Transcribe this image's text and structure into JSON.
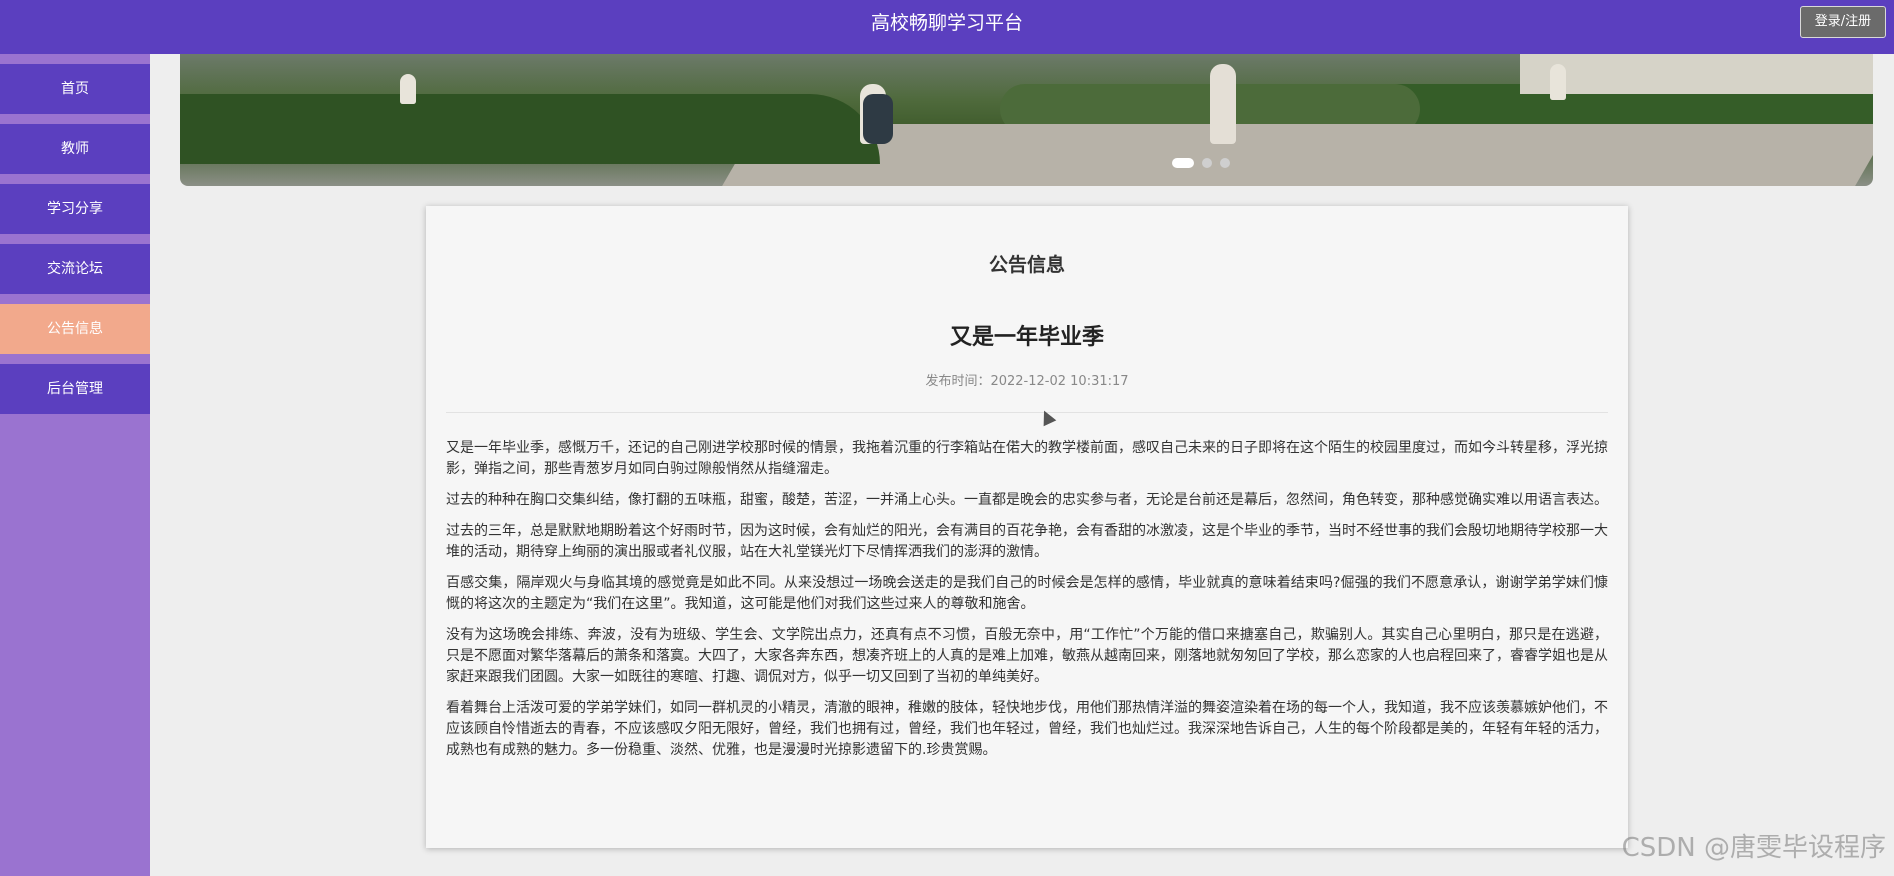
{
  "header": {
    "title": "高校畅聊学习平台",
    "login_label": "登录/注册"
  },
  "sidebar": {
    "items": [
      {
        "label": "首页"
      },
      {
        "label": "教师"
      },
      {
        "label": "学习分享"
      },
      {
        "label": "交流论坛"
      },
      {
        "label": "公告信息",
        "active": true
      },
      {
        "label": "后台管理"
      }
    ]
  },
  "banner": {
    "slide_count": 3,
    "active_index": 0
  },
  "notice": {
    "section_title": "公告信息",
    "title": "又是一年毕业季",
    "publish_label": "发布时间：",
    "publish_time": "2022-12-02 10:31:17",
    "paragraphs": [
      "又是一年毕业季，感慨万千，还记的自己刚进学校那时候的情景，我拖着沉重的行李箱站在偌大的教学楼前面，感叹自己未来的日子即将在这个陌生的校园里度过，而如今斗转星移，浮光掠影，弹指之间，那些青葱岁月如同白驹过隙般悄然从指缝溜走。",
      "过去的种种在胸口交集纠结，像打翻的五味瓶，甜蜜，酸楚，苦涩，一并涌上心头。一直都是晚会的忠实参与者，无论是台前还是幕后，忽然间，角色转变，那种感觉确实难以用语言表达。",
      "过去的三年，总是默默地期盼着这个好雨时节，因为这时候，会有灿烂的阳光，会有满目的百花争艳，会有香甜的冰激凌，这是个毕业的季节，当时不经世事的我们会殷切地期待学校那一大堆的活动，期待穿上绚丽的演出服或者礼仪服，站在大礼堂镁光灯下尽情挥洒我们的澎湃的激情。",
      "百感交集，隔岸观火与身临其境的感觉竟是如此不同。从来没想过一场晚会送走的是我们自己的时候会是怎样的感情，毕业就真的意味着结束吗?倔强的我们不愿意承认，谢谢学弟学妹们慷慨的将这次的主题定为“我们在这里”。我知道，这可能是他们对我们这些过来人的尊敬和施舍。",
      "没有为这场晚会排练、奔波，没有为班级、学生会、文学院出点力，还真有点不习惯，百般无奈中，用“工作忙”个万能的借口来搪塞自己，欺骗别人。其实自己心里明白，那只是在逃避，只是不愿面对繁华落幕后的萧条和落寞。大四了，大家各奔东西，想凑齐班上的人真的是难上加难，敏燕从越南回来，刚落地就匆匆回了学校，那么恋家的人也启程回来了，睿睿学姐也是从家赶来跟我们团圆。大家一如既往的寒暄、打趣、调侃对方，似乎一切又回到了当初的单纯美好。",
      "看着舞台上活泼可爱的学弟学妹们，如同一群机灵的小精灵，清澈的眼神，稚嫩的肢体，轻快地步伐，用他们那热情洋溢的舞姿渲染着在场的每一个人，我知道，我不应该羡慕嫉妒他们，不应该顾自怜惜逝去的青春，不应该感叹夕阳无限好，曾经，我们也拥有过，曾经，我们也年轻过，曾经，我们也灿烂过。我深深地告诉自己，人生的每个阶段都是美的，年轻有年轻的活力，成熟也有成熟的魅力。多一份稳重、淡然、优雅，也是漫漫时光掠影遗留下的.珍贵赏赐。"
    ]
  },
  "watermark": "CSDN @唐雯毕设程序"
}
